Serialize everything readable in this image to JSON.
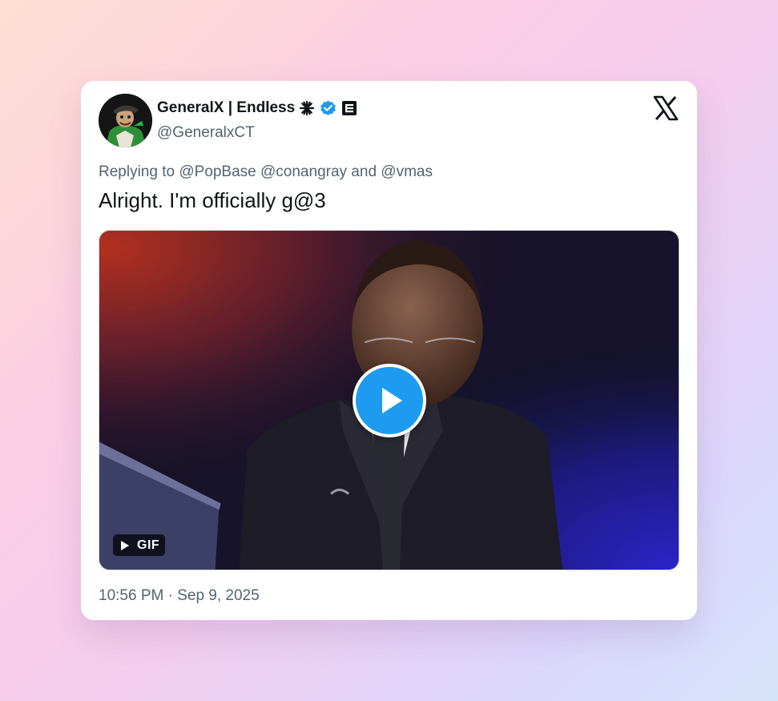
{
  "user": {
    "display_name": "GeneralX | Endless",
    "handle": "@GeneralxCT",
    "verified": true
  },
  "reply": {
    "text": "Replying to @PopBase @conangray and @vmas"
  },
  "tweet": {
    "text": "Alright. I'm officially g@3"
  },
  "media": {
    "type": "gif",
    "badge_label": "GIF"
  },
  "meta": {
    "timestamp": "10:56 PM · Sep 9, 2025"
  },
  "icons": {
    "asterisk": "asterisk-icon",
    "verified": "verified-badge-icon",
    "affiliate": "affiliate-badge-icon",
    "platform": "x-logo-icon",
    "play": "play-icon"
  },
  "colors": {
    "accent": "#1d9bf0",
    "text_primary": "#0f1419",
    "text_secondary": "#536471"
  }
}
